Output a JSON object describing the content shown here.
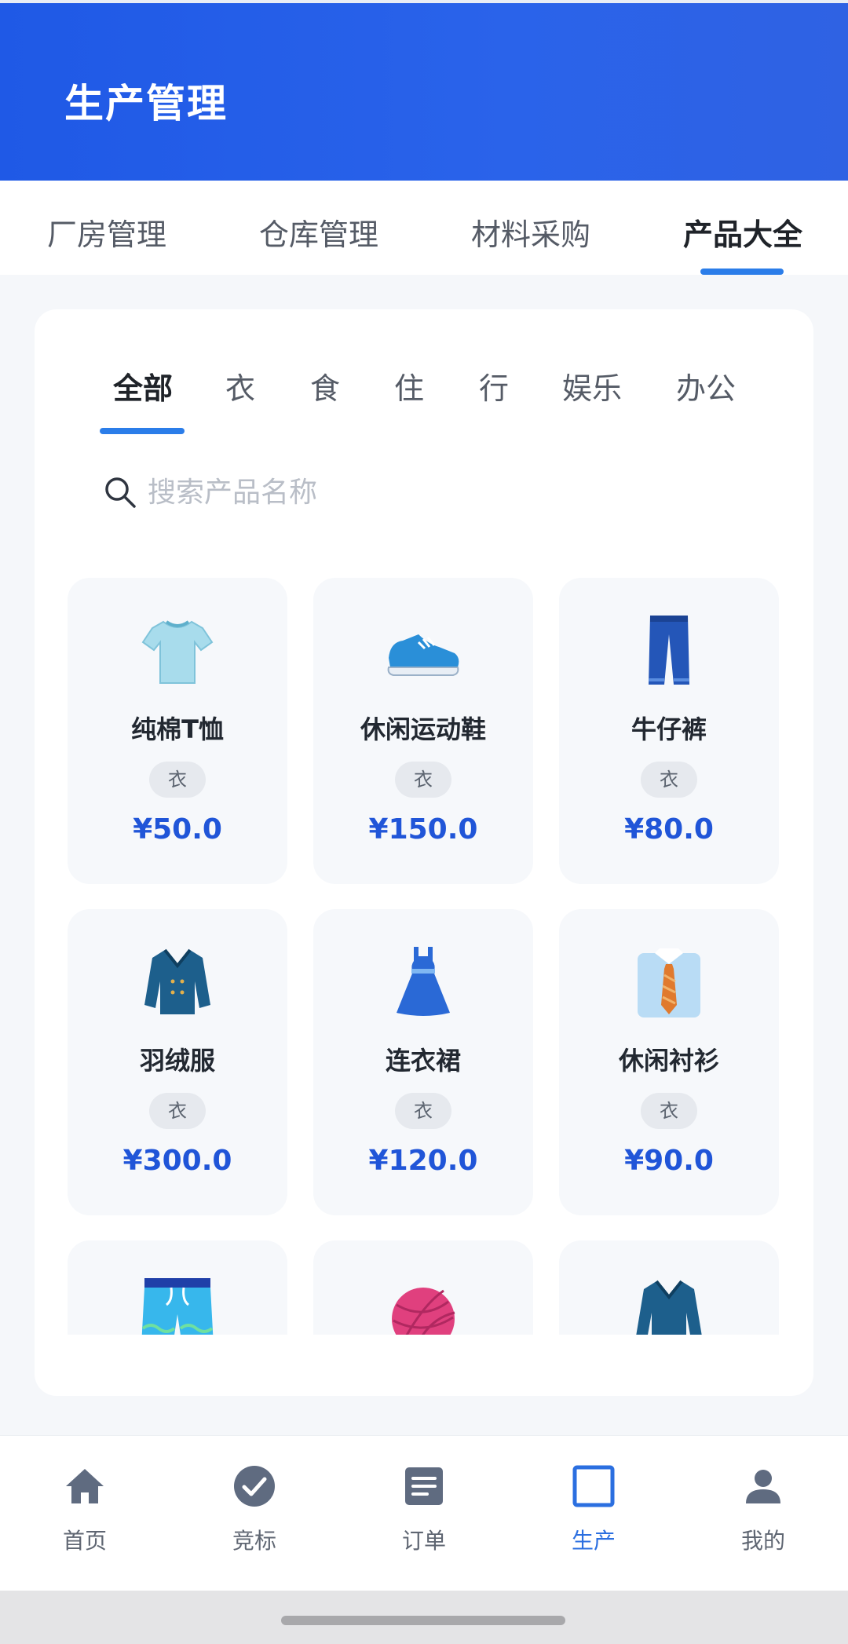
{
  "header": {
    "title": "生产管理"
  },
  "top_tabs": [
    {
      "label": "厂房管理"
    },
    {
      "label": "仓库管理"
    },
    {
      "label": "材料采购"
    },
    {
      "label": "产品大全",
      "active": true
    }
  ],
  "categories": [
    {
      "label": "全部",
      "active": true
    },
    {
      "label": "衣"
    },
    {
      "label": "食"
    },
    {
      "label": "住"
    },
    {
      "label": "行"
    },
    {
      "label": "娱乐"
    },
    {
      "label": "办公"
    }
  ],
  "search": {
    "placeholder": "搜索产品名称",
    "value": ""
  },
  "products": [
    {
      "name": "纯棉T恤",
      "tag": "衣",
      "price": "¥50.0",
      "icon": "tshirt-icon"
    },
    {
      "name": "休闲运动鞋",
      "tag": "衣",
      "price": "¥150.0",
      "icon": "sneaker-icon"
    },
    {
      "name": "牛仔裤",
      "tag": "衣",
      "price": "¥80.0",
      "icon": "jeans-icon"
    },
    {
      "name": "羽绒服",
      "tag": "衣",
      "price": "¥300.0",
      "icon": "coat-icon"
    },
    {
      "name": "连衣裙",
      "tag": "衣",
      "price": "¥120.0",
      "icon": "dress-icon"
    },
    {
      "name": "休闲衬衫",
      "tag": "衣",
      "price": "¥90.0",
      "icon": "shirt-icon"
    },
    {
      "name": "",
      "tag": "",
      "price": "",
      "icon": "shorts-icon"
    },
    {
      "name": "",
      "tag": "",
      "price": "",
      "icon": "yarn-icon"
    },
    {
      "name": "",
      "tag": "",
      "price": "",
      "icon": "coat-icon"
    }
  ],
  "bottom_nav": [
    {
      "label": "首页",
      "icon": "home-icon"
    },
    {
      "label": "竞标",
      "icon": "check-circle-icon"
    },
    {
      "label": "订单",
      "icon": "document-icon"
    },
    {
      "label": "生产",
      "icon": "square-icon",
      "active": true
    },
    {
      "label": "我的",
      "icon": "person-icon"
    }
  ],
  "colors": {
    "header_bg": "#2a63ea",
    "accent": "#2b7de9",
    "price": "#2055d8",
    "nav_active": "#2b6fe0"
  }
}
